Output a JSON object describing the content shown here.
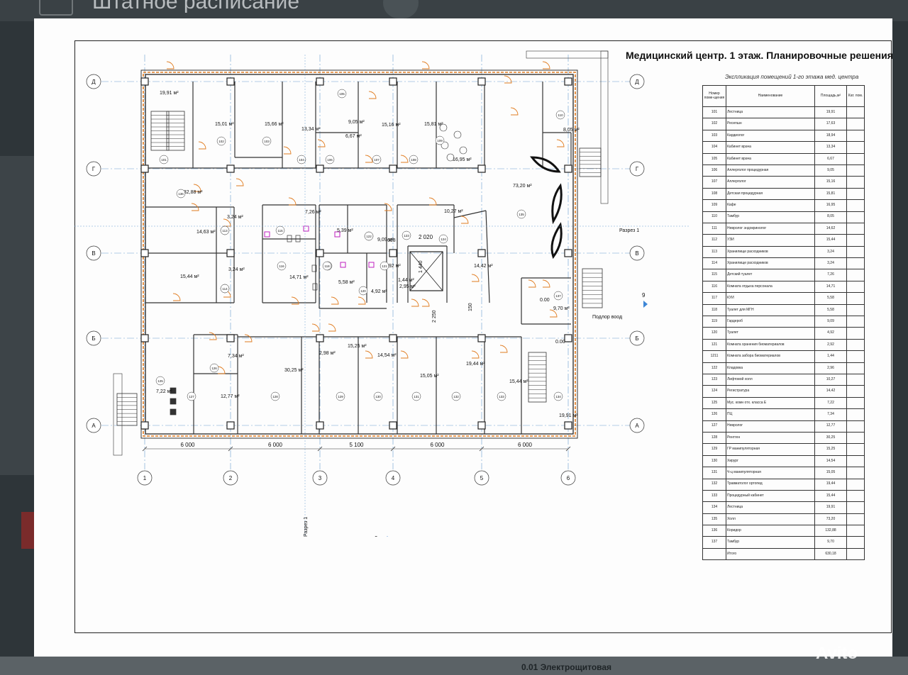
{
  "background": {
    "title": "Штатное расписание",
    "bottom_text": "0.01  Электрощитовая"
  },
  "sheet": {
    "title": "Медицинский центр. 1 этаж. Планировочные решения",
    "table_caption": "Экспликация помещений 1-го этажа мед. центра",
    "table_headers": [
      "Номер поме-щения",
      "Наименование",
      "Площадь,м²",
      "Кат. пом."
    ],
    "rows": [
      [
        "101",
        "Лестница",
        "19,91"
      ],
      [
        "102",
        "Ресепшн",
        "17,63"
      ],
      [
        "103",
        "Кардиолог",
        "18,94"
      ],
      [
        "104",
        "Кабинет врача",
        "13,34"
      ],
      [
        "105",
        "Кабинет врача",
        "6,67"
      ],
      [
        "106",
        "Аллерголог процедурная",
        "9,05"
      ],
      [
        "107",
        "Аллерголог",
        "15,16"
      ],
      [
        "108",
        "Детская процедурная",
        "15,81"
      ],
      [
        "109",
        "Кафе",
        "16,95"
      ],
      [
        "110",
        "Тамбур",
        "8,05"
      ],
      [
        "111",
        "Невролог эндокринолог",
        "14,62"
      ],
      [
        "112",
        "УЗИ",
        "15,44"
      ],
      [
        "113",
        "Хранилище расходников",
        "3,24"
      ],
      [
        "114",
        "Хранилище расходников",
        "3,24"
      ],
      [
        "115",
        "Детский туалет",
        "7,26"
      ],
      [
        "116",
        "Комната отдыха персонала",
        "14,71"
      ],
      [
        "117",
        "КУИ",
        "5,58"
      ],
      [
        "118",
        "Туалет для МГН",
        "5,58"
      ],
      [
        "119",
        "Гардероб",
        "9,09"
      ],
      [
        "120",
        "Туалет",
        "4,92"
      ],
      [
        "121",
        "Комната хранения биоматериалов",
        "2,92"
      ],
      [
        "1211",
        "Комната забора биоматериалов",
        "1,44"
      ],
      [
        "122",
        "Кладовка",
        "2,96"
      ],
      [
        "123",
        "Лифтовой холл",
        "10,27"
      ],
      [
        "124",
        "Регистратура",
        "14,42"
      ],
      [
        "125",
        "Мус. комн отх. класса Е",
        "7,22"
      ],
      [
        "126",
        "ПЦ",
        "7,34"
      ],
      [
        "127",
        "Невролог",
        "12,77"
      ],
      [
        "128",
        "Рентген",
        "30,25"
      ],
      [
        "129",
        "ГР манипуляторная",
        "15,25"
      ],
      [
        "130",
        "Хирург",
        "14,54"
      ],
      [
        "131",
        "Ч-ц манипуляторная",
        "15,05"
      ],
      [
        "132",
        "Травматолог ортопед",
        "19,44"
      ],
      [
        "133",
        "Процедурный кабинет",
        "15,44"
      ],
      [
        "134",
        "Лестница",
        "19,91"
      ],
      [
        "135",
        "Холл",
        "73,20"
      ],
      [
        "136",
        "Коридор",
        "132,88"
      ],
      [
        "137",
        "Тамбур",
        "9,70"
      ],
      [
        "",
        "Итого",
        "630,18"
      ]
    ]
  },
  "plan": {
    "axes_letters": [
      "Д",
      "Г",
      "В",
      "Б",
      "А"
    ],
    "axes_numbers": [
      "1",
      "2",
      "3",
      "4",
      "5",
      "6"
    ],
    "dimensions": [
      "6 000",
      "6 000",
      "5 100",
      "6 000",
      "6 000"
    ],
    "section_label": "Разрез 1",
    "section_mark": "9",
    "ramp_label": "Подлор воод",
    "dims_small": [
      "2 020",
      "2 250",
      "1 440",
      "150"
    ],
    "room_areas": [
      "19,91 м²",
      "15,01 м²",
      "15,66 м²",
      "13,34 м²",
      "9,05 м²",
      "6,67 м²",
      "15,16 м²",
      "15,81 м²",
      "16,95 м²",
      "8,05 м²",
      "132,88 м²",
      "73,20 м²",
      "14,63 м²",
      "3,24 м²",
      "7,26 м²",
      "5,39 м²",
      "9,09 м²",
      "10,27 м²",
      "15,44 м²",
      "3,24 м²",
      "14,71 м²",
      "5,58 м²",
      "4,92 м²",
      "2,92 м²",
      "1,44 м²",
      "2,95 м²",
      "14,42 м²",
      "9,70 м²",
      "7,34 м²",
      "2,98 м²",
      "15,25 м²",
      "14,54 м²",
      "15,05 м²",
      "19,44 м²",
      "30,25 м²",
      "12,77 м²",
      "7,22 м²",
      "15,44 м²",
      "19,91 м²"
    ],
    "area_extra": [
      "658",
      "0.00",
      "0.00"
    ],
    "room_numbers": [
      "101",
      "102",
      "103",
      "104",
      "105",
      "106",
      "107",
      "108",
      "109",
      "110",
      "111",
      "112",
      "113",
      "114",
      "115",
      "116",
      "117",
      "118",
      "119",
      "120",
      "121",
      "122",
      "123",
      "124",
      "125",
      "126",
      "127",
      "128",
      "129",
      "130",
      "131",
      "132",
      "133",
      "134",
      "135",
      "136",
      "137"
    ]
  },
  "watermark": "Avito",
  "colors": {
    "walls": "#333333",
    "doors": "#e07b1f",
    "fixtures": "#c020c0",
    "axis": "#6a9ecf",
    "accent": "#3d86d6"
  }
}
